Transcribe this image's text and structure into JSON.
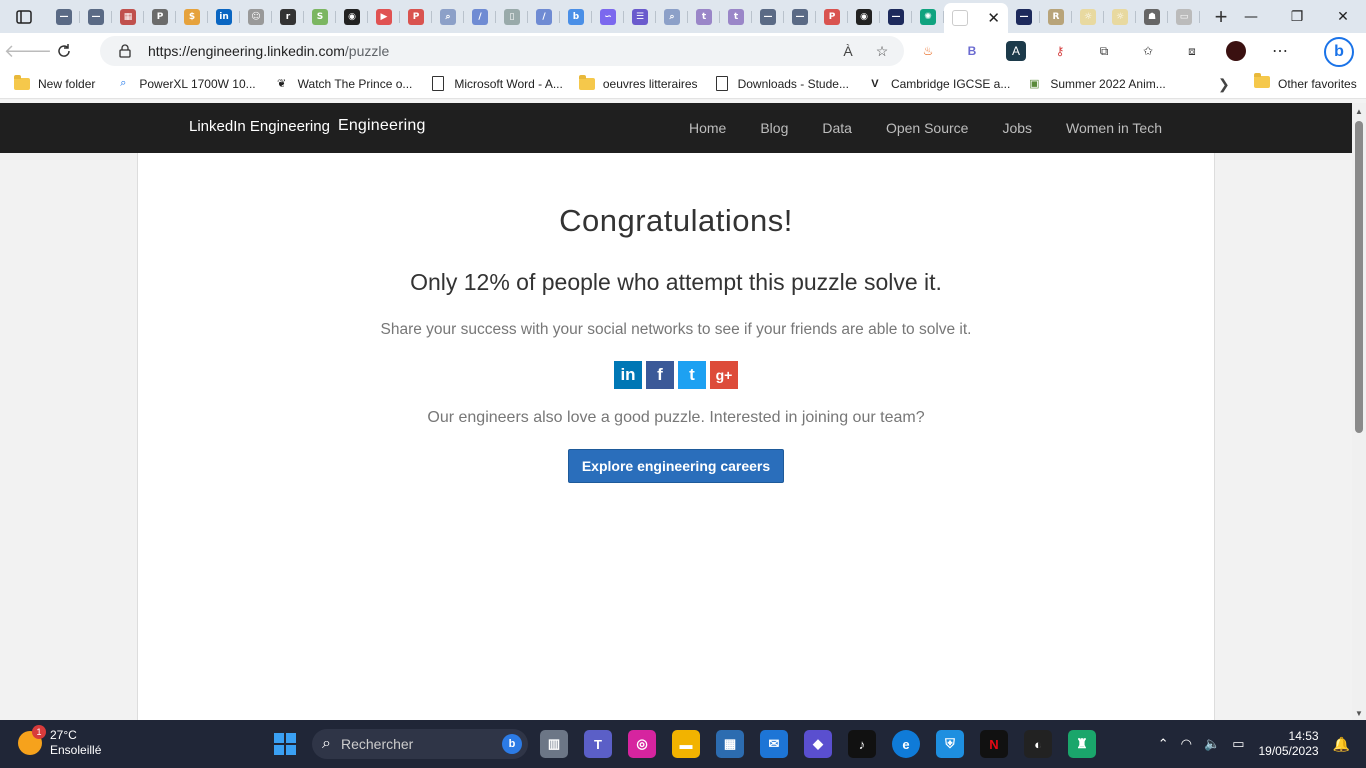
{
  "browser": {
    "active_tab_title": "",
    "tab_close": "✕",
    "new_tab": "+",
    "win_min": "—",
    "win_max": "❐",
    "win_close": "✕",
    "url_host": "https://engineering.linkedin.com",
    "url_path": "/puzzle",
    "read_aloud": "À",
    "favorites_bar": [
      {
        "label": "New folder",
        "icon": "folder-icon"
      },
      {
        "label": "PowerXL 1700W 10...",
        "icon": "search-icon"
      },
      {
        "label": "Watch The Prince o...",
        "icon": "feather-icon"
      },
      {
        "label": "Microsoft Word - A...",
        "icon": "document-icon"
      },
      {
        "label": "oeuvres litteraires",
        "icon": "folder-icon"
      },
      {
        "label": "Downloads - Stude...",
        "icon": "document-icon"
      },
      {
        "label": "Cambridge IGCSE a...",
        "icon": "v-icon"
      },
      {
        "label": "Summer 2022 Anim...",
        "icon": "image-icon"
      }
    ],
    "other_favorites": "Other favorites"
  },
  "site": {
    "logo_alt": "LinkedIn Engineering",
    "brand": "Engineering",
    "nav": [
      "Home",
      "Blog",
      "Data",
      "Open Source",
      "Jobs",
      "Women in Tech"
    ]
  },
  "main": {
    "heading": "Congratulations!",
    "stat": "Only 12% of people who attempt this puzzle solve it.",
    "share_text": "Share your success with your social networks to see if your friends are able to solve it.",
    "socials": [
      {
        "name": "LinkedIn",
        "glyph": "in",
        "color": "#0077b5"
      },
      {
        "name": "Facebook",
        "glyph": "f",
        "color": "#3b5998"
      },
      {
        "name": "Twitter",
        "glyph": "t",
        "color": "#1da1f2"
      },
      {
        "name": "Google+",
        "glyph": "g+",
        "color": "#dd4b39"
      }
    ],
    "join_text": "Our engineers also love a good puzzle. Interested in joining our team?",
    "cta": "Explore engineering careers"
  },
  "taskbar": {
    "weather_temp": "27°C",
    "weather_desc": "Ensoleillé",
    "weather_badge": "1",
    "search_placeholder": "Rechercher",
    "time": "14:53",
    "date": "19/05/2023"
  }
}
